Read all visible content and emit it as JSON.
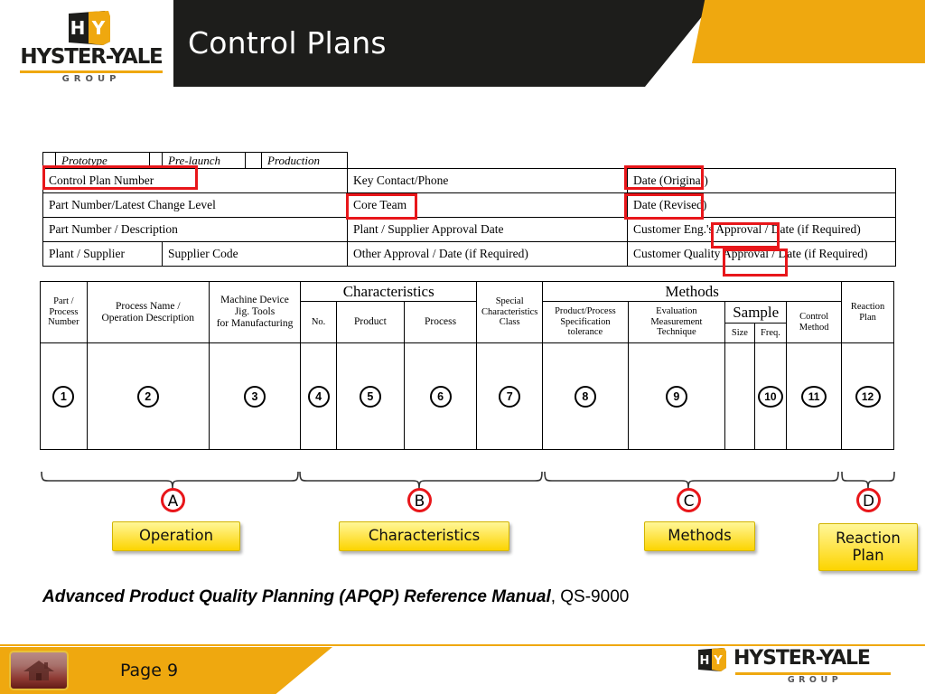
{
  "slide": {
    "title": "Control Plans",
    "brand": {
      "wordmark": "HYSTER-YALE",
      "group": "GROUP",
      "mark_h": "H",
      "mark_y": "Y"
    },
    "footer": {
      "page_label": "Page 9",
      "home_icon": "home-icon"
    },
    "source_note": {
      "italic_part": "Advanced Product Quality Planning (APQP) Reference Manual",
      "plain_part": ", QS-9000"
    },
    "colors": {
      "brand_yellow": "#efa80f",
      "header_black": "#1d1d1b",
      "annotation_red": "#e8161a",
      "callout_yellow": "#ffe95e"
    }
  },
  "info_table": {
    "phases": [
      "Prototype",
      "Pre-launch",
      "Production"
    ],
    "rows": [
      {
        "left": "Control Plan Number",
        "left2": "",
        "middle": "Key Contact/Phone",
        "right": "Date (Original)"
      },
      {
        "left": "Part Number/Latest Change Level",
        "left2": "",
        "middle": "Core Team",
        "right": "Date (Revised)"
      },
      {
        "left": "Part Number / Description",
        "left2": "",
        "middle": "Plant / Supplier Approval Date",
        "right": "Customer Eng.'s Approval / Date (if Required)"
      },
      {
        "left": "Plant / Supplier",
        "left2": "Supplier Code",
        "middle": "Other Approval / Date (if Required)",
        "right": "Customer Quality Approval / Date (if Required)"
      }
    ]
  },
  "main_table": {
    "group_headers": {
      "characteristics": "Characteristics",
      "methods": "Methods",
      "sample": "Sample"
    },
    "columns": [
      {
        "label": "Part /\nProcess\nNumber",
        "number": "1"
      },
      {
        "label": "Process Name /\nOperation Description",
        "number": "2"
      },
      {
        "label": "Machine Device\nJig. Tools\nfor Manufacturing",
        "number": "3"
      },
      {
        "label": "No.",
        "number": "4"
      },
      {
        "label": "Product",
        "number": "5"
      },
      {
        "label": "Process",
        "number": "6"
      },
      {
        "label": "Special\nCharacteristics\nClass",
        "number": "7"
      },
      {
        "label": "Product/Process\nSpecification\ntolerance",
        "number": "8"
      },
      {
        "label": "Evaluation\nMeasurement\nTechnique",
        "number": "9"
      },
      {
        "label": "Size",
        "number": ""
      },
      {
        "label": "Freq.",
        "number": "10"
      },
      {
        "label": "Control\nMethod",
        "number": "11"
      },
      {
        "label": "Reaction\nPlan",
        "number": "12"
      }
    ]
  },
  "callouts": [
    {
      "letter": "A",
      "label": "Operation"
    },
    {
      "letter": "B",
      "label": "Characteristics"
    },
    {
      "letter": "C",
      "label": "Methods"
    },
    {
      "letter": "D",
      "label": "Reaction\nPlan"
    }
  ]
}
